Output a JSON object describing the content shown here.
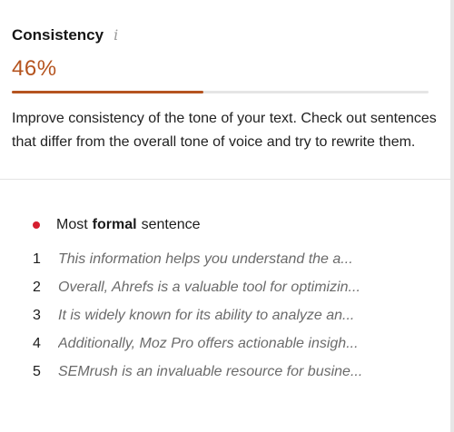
{
  "consistency": {
    "title": "Consistency",
    "info_icon": "info-icon",
    "score": "46%",
    "progress": 0.46,
    "accent_color": "#b5541f",
    "description": "Improve consistency of the tone of your text. Check out sentences that differ from the overall tone of voice and try to rewrite them."
  },
  "formal_list": {
    "dot_color": "#d51f2f",
    "header_prefix": "Most",
    "header_bold": "formal",
    "header_suffix": "sentence",
    "items": [
      {
        "number": "1",
        "text": "This information helps you understand the a..."
      },
      {
        "number": "2",
        "text": "Overall, Ahrefs is a valuable tool for optimizin..."
      },
      {
        "number": "3",
        "text": "It is widely known for its ability to analyze an..."
      },
      {
        "number": "4",
        "text": "Additionally, Moz Pro offers actionable insigh..."
      },
      {
        "number": "5",
        "text": "SEMrush is an invaluable resource for busine..."
      }
    ]
  }
}
